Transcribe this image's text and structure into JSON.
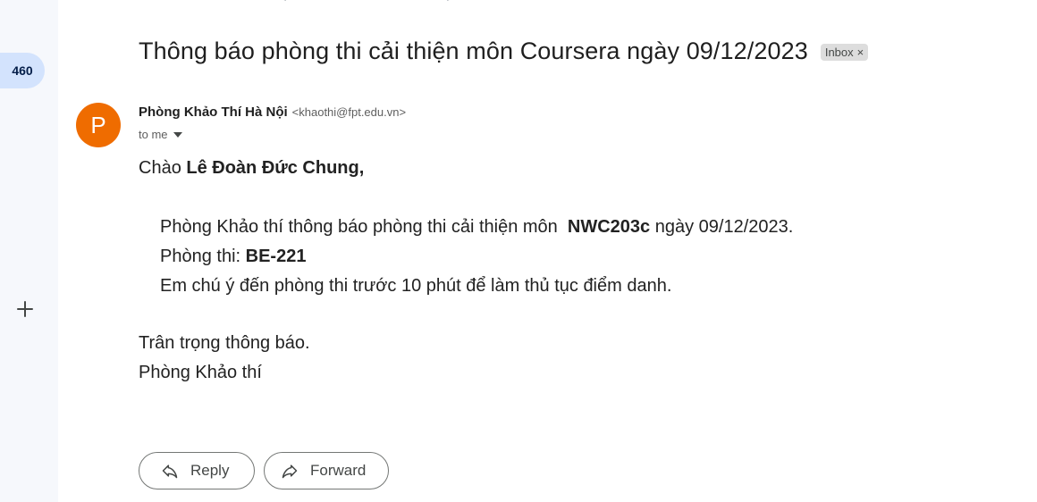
{
  "sidebar": {
    "unread_count": "460"
  },
  "message": {
    "subject": "Thông báo phòng thi cải thiện môn Coursera ngày 09/12/2023",
    "label": "Inbox",
    "label_close": "×",
    "avatar_letter": "P",
    "sender_name": "Phòng Khảo Thí Hà Nội",
    "sender_email": "<khaothi@fpt.edu.vn>",
    "recipient": "to me"
  },
  "body": {
    "greeting_prefix": "Chào ",
    "greeting_name": "Lê Đoàn Đức Chung,",
    "line1_prefix": "Phòng Khảo thí thông báo phòng thi cải thiện môn  ",
    "line1_course": "NWC203c",
    "line1_suffix": " ngày 09/12/2023.",
    "line2_prefix": "Phòng thi: ",
    "line2_room": "BE-221",
    "line3": "Em chú ý đến phòng thi trước 10 phút để làm thủ tục điểm danh.",
    "closing": "Trân trọng thông báo.",
    "signature": "Phòng Khảo thí"
  },
  "actions": {
    "reply_label": "Reply",
    "forward_label": "Forward"
  },
  "icons": {
    "plus": "plus-icon",
    "caret": "chevron-down-icon",
    "reply": "reply-icon",
    "forward": "forward-icon"
  },
  "colors": {
    "avatar_bg": "#ef6c00",
    "count_pill_bg": "#d3e3fd",
    "rail_bg": "#f6f8fc",
    "label_bg": "#dddddd"
  }
}
